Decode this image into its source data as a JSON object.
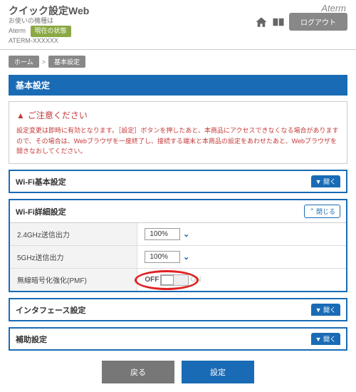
{
  "header": {
    "app_title": "クイック設定Web",
    "sub1": "お使いの機種は",
    "sub2": "ATERM-XXXXXX",
    "brand_prefix": "Aterm",
    "status_label": "現在の状態",
    "brand": "Aterm",
    "logout": "ログアウト"
  },
  "breadcrumb": {
    "items": [
      "ホーム",
      "基本設定"
    ],
    "sep": ">"
  },
  "section_title": "基本設定",
  "notice": {
    "title": "ご注意ください",
    "text": "設定変更は即時に有効となります。［設定］ボタンを押したあと、本商品にアクセスできなくなる場合がありますので、その場合は、Webブラウザを一度終了し、接続する端末と本商品の設定をあわせたあと、Webブラウザを開きなおしてください。"
  },
  "panels": {
    "wifi_basic": {
      "title": "Wi-Fi基本設定",
      "action": "▼ 開く"
    },
    "wifi_detail": {
      "title": "Wi-Fi詳細設定",
      "action": "閉じる",
      "rows": {
        "tx24": {
          "label": "2.4GHz送信出力",
          "value": "100%"
        },
        "tx5": {
          "label": "5GHz送信出力",
          "value": "100%"
        },
        "pmf": {
          "label": "無線暗号化強化(PMF)",
          "off": "OFF",
          "on": "ON"
        }
      }
    },
    "interface": {
      "title": "インタフェース設定",
      "action": "▼ 開く"
    },
    "aux": {
      "title": "補助設定",
      "action": "▼ 開く"
    }
  },
  "footer": {
    "back": "戻る",
    "submit": "設定"
  }
}
